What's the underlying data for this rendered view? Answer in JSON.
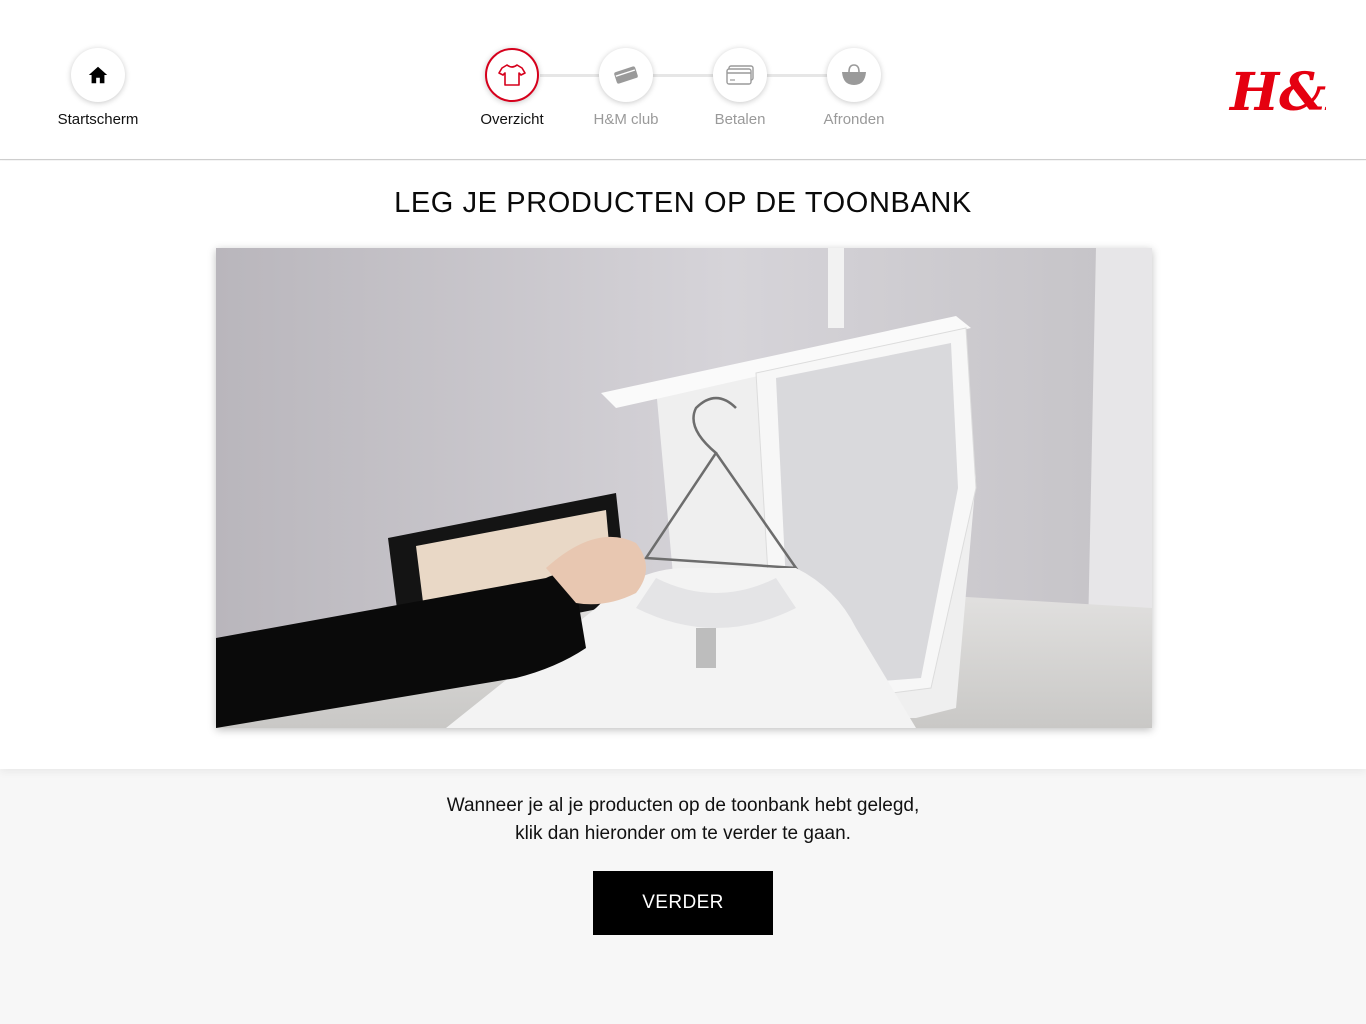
{
  "header": {
    "home_label": "Startscherm",
    "steps": [
      {
        "label": "Overzicht",
        "icon": "tshirt-icon",
        "active": true
      },
      {
        "label": "H&M club",
        "icon": "club-card-icon",
        "active": false
      },
      {
        "label": "Betalen",
        "icon": "credit-card-icon",
        "active": false
      },
      {
        "label": "Afronden",
        "icon": "shopping-bag-icon",
        "active": false
      }
    ],
    "logo_text": "H&M"
  },
  "main": {
    "title": "LEG JE PRODUCTEN OP DE TOONBANK",
    "video_alt": "Instruction video: placing clothing on the self-checkout counter",
    "instruction_line1": "Wanneer je al je producten op de toonbank hebt gelegd,",
    "instruction_line2": "klik dan hieronder om te verder te gaan.",
    "continue_label": "VERDER"
  },
  "colors": {
    "accent": "#d6001c",
    "button_bg": "#000000",
    "page_bg": "#f7f7f7"
  }
}
